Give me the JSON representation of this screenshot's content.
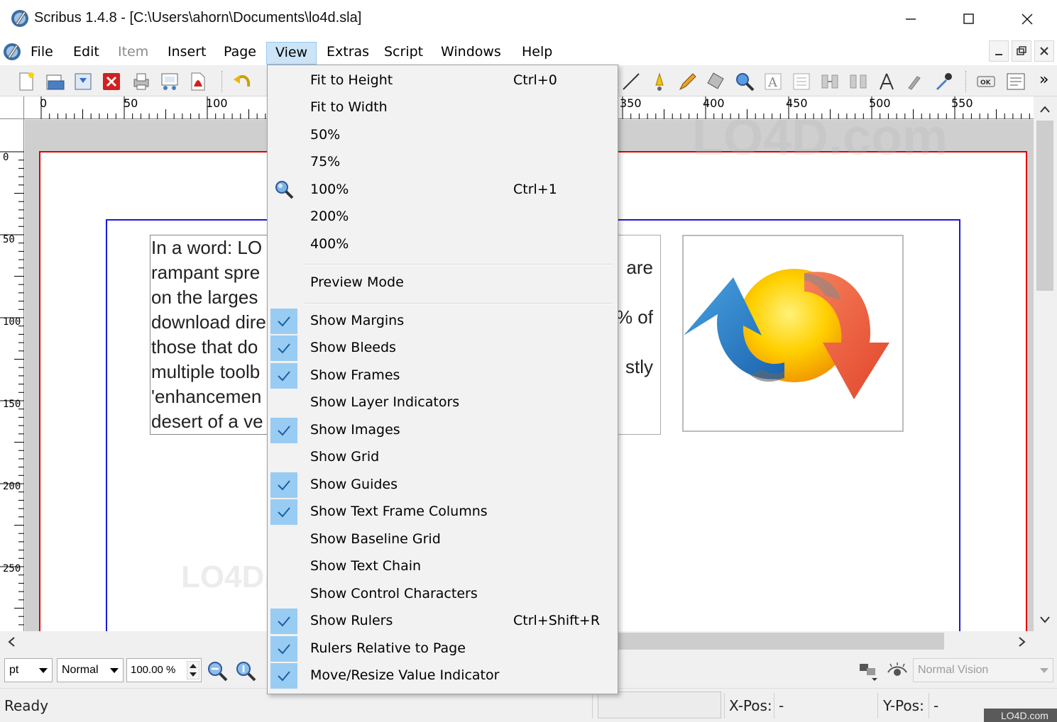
{
  "window": {
    "title": "Scribus 1.4.8 - [C:\\Users\\ahorn\\Documents\\lo4d.sla]"
  },
  "menubar": {
    "items": [
      {
        "label": "File",
        "state": "normal"
      },
      {
        "label": "Edit",
        "state": "normal"
      },
      {
        "label": "Item",
        "state": "disabled"
      },
      {
        "label": "Insert",
        "state": "normal"
      },
      {
        "label": "Page",
        "state": "normal"
      },
      {
        "label": "View",
        "state": "active"
      },
      {
        "label": "Extras",
        "state": "normal"
      },
      {
        "label": "Script",
        "state": "normal"
      },
      {
        "label": "Windows",
        "state": "normal"
      },
      {
        "label": "Help",
        "state": "normal"
      }
    ]
  },
  "toolbar": {
    "overflow": "»"
  },
  "rulers": {
    "horizontal": [
      "0",
      "50",
      "100",
      "350",
      "400",
      "450",
      "500",
      "550"
    ],
    "vertical": [
      "0",
      "50",
      "100",
      "150",
      "200",
      "250"
    ]
  },
  "document": {
    "text_frame_1": [
      "In a word: LO",
      "rampant spre",
      "on the larges",
      "download dire",
      "those that do",
      "multiple toolb",
      "'enhancemen",
      "desert of a ve"
    ],
    "text_frame_2": [
      "are",
      "% of",
      "stly"
    ],
    "watermark": "LO4D.com"
  },
  "view_menu": {
    "items": [
      {
        "type": "item",
        "label": "Fit to Height",
        "shortcut": "Ctrl+0",
        "checked": false
      },
      {
        "type": "item",
        "label": "Fit to Width",
        "shortcut": "",
        "checked": false
      },
      {
        "type": "item",
        "label": "50%",
        "shortcut": "",
        "checked": false
      },
      {
        "type": "item",
        "label": "75%",
        "shortcut": "",
        "checked": false
      },
      {
        "type": "item",
        "label": "100%",
        "shortcut": "Ctrl+1",
        "checked": false,
        "icon": "zoom-icon"
      },
      {
        "type": "item",
        "label": "200%",
        "shortcut": "",
        "checked": false
      },
      {
        "type": "item",
        "label": "400%",
        "shortcut": "",
        "checked": false
      },
      {
        "type": "separator"
      },
      {
        "type": "item",
        "label": "Preview Mode",
        "shortcut": "",
        "checked": false
      },
      {
        "type": "separator"
      },
      {
        "type": "item",
        "label": "Show Margins",
        "shortcut": "",
        "checked": true
      },
      {
        "type": "item",
        "label": "Show Bleeds",
        "shortcut": "",
        "checked": true
      },
      {
        "type": "item",
        "label": "Show Frames",
        "shortcut": "",
        "checked": true
      },
      {
        "type": "item",
        "label": "Show Layer Indicators",
        "shortcut": "",
        "checked": false
      },
      {
        "type": "item",
        "label": "Show Images",
        "shortcut": "",
        "checked": true
      },
      {
        "type": "item",
        "label": "Show Grid",
        "shortcut": "",
        "checked": false
      },
      {
        "type": "item",
        "label": "Show Guides",
        "shortcut": "",
        "checked": true
      },
      {
        "type": "item",
        "label": "Show Text Frame Columns",
        "shortcut": "",
        "checked": true
      },
      {
        "type": "item",
        "label": "Show Baseline Grid",
        "shortcut": "",
        "checked": false
      },
      {
        "type": "item",
        "label": "Show Text Chain",
        "shortcut": "",
        "checked": false
      },
      {
        "type": "item",
        "label": "Show Control Characters",
        "shortcut": "",
        "checked": false
      },
      {
        "type": "item",
        "label": "Show Rulers",
        "shortcut": "Ctrl+Shift+R",
        "checked": true
      },
      {
        "type": "item",
        "label": "Rulers Relative to Page",
        "shortcut": "",
        "checked": true
      },
      {
        "type": "item",
        "label": "Move/Resize Value Indicator",
        "shortcut": "",
        "checked": true
      }
    ]
  },
  "bottombar": {
    "unit": "pt",
    "mode": "Normal",
    "zoom": "100.00 %",
    "vision": "Normal Vision"
  },
  "statusbar": {
    "status": "Ready",
    "xpos_label": "X-Pos:",
    "xpos_value": "-",
    "ypos_label": "Y-Pos:",
    "ypos_value": "-",
    "corner_logo": "LO4D.com"
  },
  "colors": {
    "menu_highlight": "#cce4f7",
    "check_bg": "#99ccf2",
    "bleed_line": "#e00000",
    "margin_line": "#1a1ad8"
  }
}
